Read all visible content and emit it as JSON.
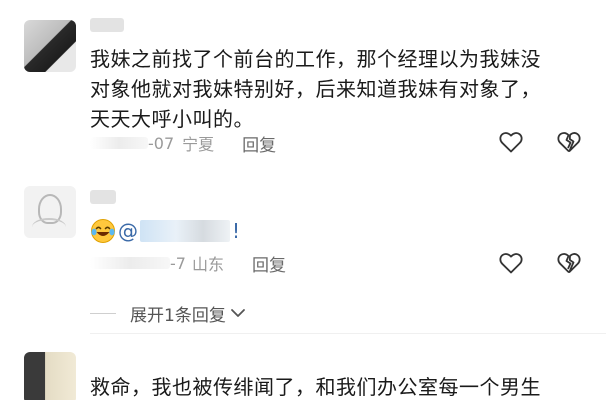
{
  "comments": [
    {
      "text": "我妹之前找了个前台的工作，那个经理以为我妹没\n对象他就对我妹特别好，后来知道我妹有对象了，\n天天大呼小叫的。",
      "date_partial": "-07",
      "location": "宁夏",
      "reply_label": "回复"
    },
    {
      "mention_prefix": "@",
      "mention_suffix": "!",
      "date_partial": "-7",
      "location": "山东",
      "reply_label": "回复"
    },
    {
      "text": "救命，我也被传绯闻了，和我们办公室每一个男生"
    }
  ],
  "expand_label": "展开1条回复",
  "icons": {
    "like": "heart-outline-icon",
    "dislike": "broken-heart-icon",
    "emoji": "laughing-tears-emoji-icon",
    "expand": "chevron-down-icon"
  },
  "colors": {
    "text": "#1a1a1a",
    "meta": "#9a9a9a",
    "mention": "#3b6aa8"
  }
}
